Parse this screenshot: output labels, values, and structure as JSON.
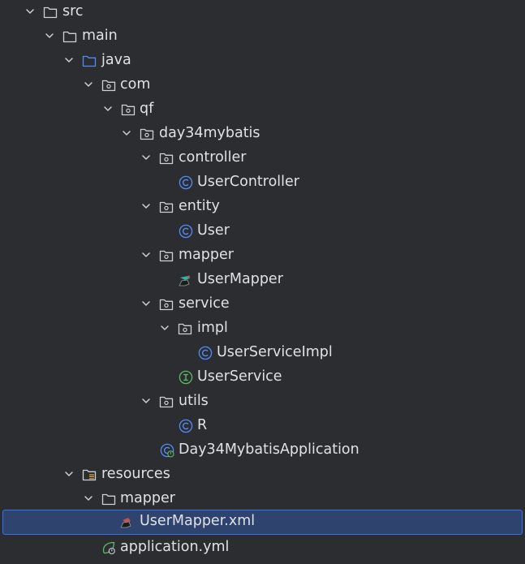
{
  "tree": {
    "src": "src",
    "main": "main",
    "java": "java",
    "com": "com",
    "qf": "qf",
    "day34mybatis": "day34mybatis",
    "controller": "controller",
    "user_controller": "UserController",
    "entity": "entity",
    "user": "User",
    "mapper_pkg": "mapper",
    "user_mapper": "UserMapper",
    "service": "service",
    "impl": "impl",
    "user_service_impl": "UserServiceImpl",
    "user_service": "UserService",
    "utils": "utils",
    "r_class": "R",
    "application_class": "Day34MybatisApplication",
    "resources": "resources",
    "mapper_dir": "mapper",
    "user_mapper_xml": "UserMapper.xml",
    "application_yml": "application.yml"
  },
  "colors": {
    "background": "#2b2d30",
    "text": "#dfe1e5",
    "selection_bg": "#2e436e",
    "selection_border": "#3574f0",
    "class_icon": "#548af7",
    "interface_icon": "#5fb865",
    "folder_icon": "#ced0d6",
    "source_root_icon": "#548af7",
    "spring_icon": "#5fb865",
    "mybatis_icon": "#c94f4f"
  },
  "icons": {
    "expanded": "chevron-down-icon",
    "folder": "folder-icon",
    "source_folder": "source-folder-icon",
    "package": "package-icon",
    "class": "class-icon",
    "interface": "interface-icon",
    "mybatis": "mybatis-icon",
    "resources_folder": "resources-folder-icon",
    "spring_app": "spring-application-icon",
    "spring_yml": "spring-config-icon"
  }
}
